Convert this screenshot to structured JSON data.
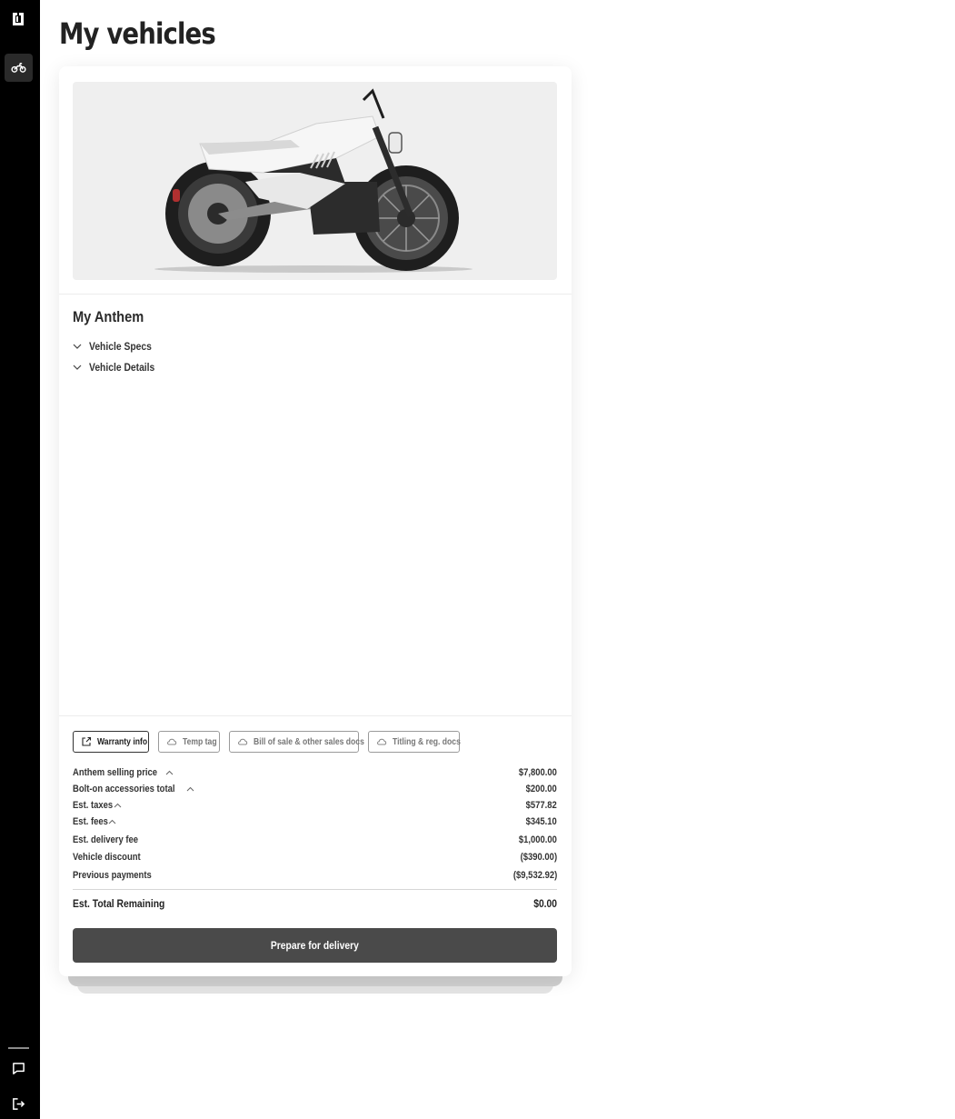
{
  "sidebar": {
    "logo_icon": "brand-logo-icon",
    "nav_icon": "motorcycle-icon",
    "chat_icon": "chat-icon",
    "logout_icon": "logout-icon",
    "bg_color": "#000000",
    "active_color": "#2a2a2a"
  },
  "page": {
    "title": "My vehicles"
  },
  "vehicle": {
    "name": "My Anthem",
    "sections": [
      {
        "label": "Vehicle Specs",
        "expanded": false
      },
      {
        "label": "Vehicle Details",
        "expanded": false
      }
    ]
  },
  "documents": {
    "buttons": [
      {
        "label": "Warranty info",
        "icon": "external-link-icon"
      },
      {
        "label": "Temp tag",
        "icon": "cloud-icon"
      },
      {
        "label": "Bill of sale & other sales docs",
        "icon": "cloud-icon"
      },
      {
        "label": "Titling & reg. docs",
        "icon": "cloud-icon"
      }
    ]
  },
  "pricing": {
    "rows": [
      {
        "label": "Anthem selling price",
        "value": "$7,800.00",
        "expandable": true
      },
      {
        "label": "Bolt-on accessories total",
        "value": "$200.00",
        "expandable": true
      },
      {
        "label": "Est. taxes",
        "value": "$577.82",
        "expandable": true
      },
      {
        "label": "Est. fees",
        "value": "$345.10",
        "expandable": true
      },
      {
        "label": "Est. delivery fee",
        "value": "$1,000.00",
        "expandable": false
      },
      {
        "label": "Vehicle discount",
        "value": "($390.00)",
        "expandable": false
      },
      {
        "label": "Previous payments",
        "value": "($9,532.92)",
        "expandable": false
      }
    ],
    "total": {
      "label": "Est. Total Remaining",
      "value": "$0.00"
    }
  },
  "cta": {
    "label": "Prepare for delivery",
    "color": "#4a4a4a"
  }
}
